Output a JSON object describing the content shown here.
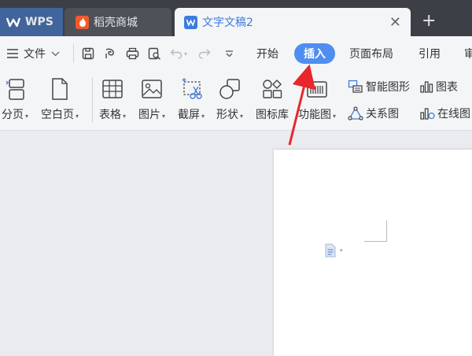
{
  "tabs": [
    {
      "label": "WPS",
      "icon": "wps-logo-icon"
    },
    {
      "label": "稻壳商城",
      "icon": "daoke-flame-icon"
    },
    {
      "label": "文字文稿2",
      "icon": "word-doc-icon"
    }
  ],
  "menu": {
    "file": "文件",
    "items": [
      "开始",
      "插入",
      "页面布局",
      "引用",
      "审"
    ],
    "active": "插入"
  },
  "ribbon": {
    "big_buttons": [
      "分页",
      "空白页",
      "表格",
      "图片",
      "截屏",
      "形状",
      "图标库",
      "功能图"
    ],
    "small_buttons": [
      "智能图形",
      "图表",
      "关系图",
      "在线图"
    ]
  },
  "colors": {
    "accent": "#4f8ef0",
    "titlebar": "#3c3f45",
    "arrow": "#e8262c"
  }
}
